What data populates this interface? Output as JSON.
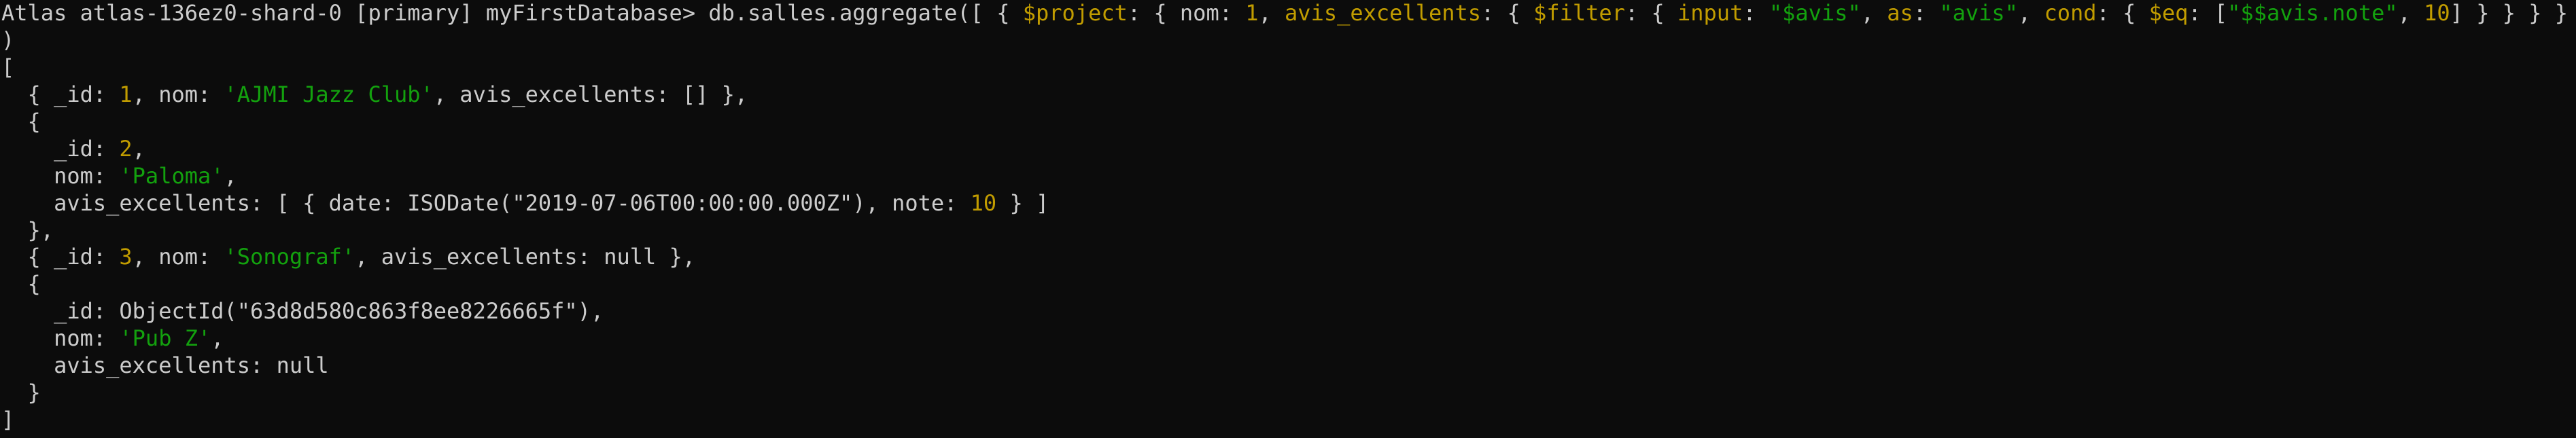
{
  "colors": {
    "background": "#0c0c0c",
    "default": "#cccccc",
    "yellow": "#c19c00",
    "green": "#13a10e"
  },
  "terminal": {
    "lines": [
      [
        {
          "text": "Atlas atlas-136ez0-shard-0 [primary] myFirstDatabase> db.salles.aggregate([ { ",
          "color": "default"
        },
        {
          "text": "$project",
          "color": "yellow"
        },
        {
          "text": ": { nom: ",
          "color": "default"
        },
        {
          "text": "1",
          "color": "yellow"
        },
        {
          "text": ", ",
          "color": "default"
        },
        {
          "text": "avis_excellents",
          "color": "yellow"
        },
        {
          "text": ": { ",
          "color": "default"
        },
        {
          "text": "$filter",
          "color": "yellow"
        },
        {
          "text": ": { ",
          "color": "default"
        },
        {
          "text": "input",
          "color": "yellow"
        },
        {
          "text": ": ",
          "color": "default"
        },
        {
          "text": "\"$avis\"",
          "color": "green"
        },
        {
          "text": ", ",
          "color": "default"
        },
        {
          "text": "as",
          "color": "yellow"
        },
        {
          "text": ": ",
          "color": "default"
        },
        {
          "text": "\"avis\"",
          "color": "green"
        },
        {
          "text": ", ",
          "color": "default"
        },
        {
          "text": "cond",
          "color": "yellow"
        },
        {
          "text": ": { ",
          "color": "default"
        },
        {
          "text": "$eq",
          "color": "yellow"
        },
        {
          "text": ": [",
          "color": "default"
        },
        {
          "text": "\"$$avis.note\"",
          "color": "green"
        },
        {
          "text": ", ",
          "color": "default"
        },
        {
          "text": "10",
          "color": "yellow"
        },
        {
          "text": "] } } } } }])",
          "color": "default"
        }
      ],
      [
        {
          "text": ")",
          "color": "default"
        }
      ],
      [
        {
          "text": "[",
          "color": "default"
        }
      ],
      [
        {
          "text": "  { _id: ",
          "color": "default"
        },
        {
          "text": "1",
          "color": "yellow"
        },
        {
          "text": ", nom: ",
          "color": "default"
        },
        {
          "text": "'AJMI Jazz Club'",
          "color": "green"
        },
        {
          "text": ", avis_excellents: [] },",
          "color": "default"
        }
      ],
      [
        {
          "text": "  {",
          "color": "default"
        }
      ],
      [
        {
          "text": "    _id: ",
          "color": "default"
        },
        {
          "text": "2",
          "color": "yellow"
        },
        {
          "text": ",",
          "color": "default"
        }
      ],
      [
        {
          "text": "    nom: ",
          "color": "default"
        },
        {
          "text": "'Paloma'",
          "color": "green"
        },
        {
          "text": ",",
          "color": "default"
        }
      ],
      [
        {
          "text": "    avis_excellents: [ { date: ISODate(\"2019-07-06T00:00:00.000Z\"), note: ",
          "color": "default"
        },
        {
          "text": "10",
          "color": "yellow"
        },
        {
          "text": " } ]",
          "color": "default"
        }
      ],
      [
        {
          "text": "  },",
          "color": "default"
        }
      ],
      [
        {
          "text": "  { _id: ",
          "color": "default"
        },
        {
          "text": "3",
          "color": "yellow"
        },
        {
          "text": ", nom: ",
          "color": "default"
        },
        {
          "text": "'Sonograf'",
          "color": "green"
        },
        {
          "text": ", avis_excellents: null },",
          "color": "default"
        }
      ],
      [
        {
          "text": "  {",
          "color": "default"
        }
      ],
      [
        {
          "text": "    _id: ObjectId(\"63d8d580c863f8ee8226665f\"),",
          "color": "default"
        }
      ],
      [
        {
          "text": "    nom: ",
          "color": "default"
        },
        {
          "text": "'Pub Z'",
          "color": "green"
        },
        {
          "text": ",",
          "color": "default"
        }
      ],
      [
        {
          "text": "    avis_excellents: null",
          "color": "default"
        }
      ],
      [
        {
          "text": "  }",
          "color": "default"
        }
      ],
      [
        {
          "text": "]",
          "color": "default"
        }
      ]
    ]
  }
}
